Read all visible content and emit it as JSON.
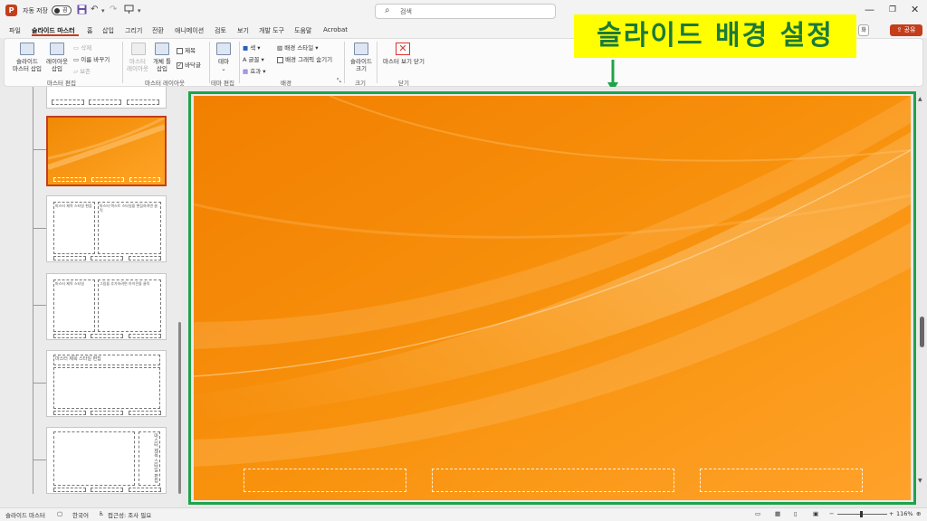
{
  "titlebar": {
    "app_icon": "powerpoint-icon",
    "autosave_label": "자동 저장",
    "autosave_state": "끔",
    "search_placeholder": "검색"
  },
  "menu": {
    "tabs": [
      "파일",
      "슬라이드 마스터",
      "홈",
      "삽입",
      "그리기",
      "전환",
      "애니메이션",
      "검토",
      "보기",
      "개발 도구",
      "도움말",
      "Acrobat"
    ],
    "active_tab": "슬라이드 마스터",
    "right_partial": "화",
    "share_label": "공유"
  },
  "ribbon": {
    "insert_slide_master": "슬라이드\n마스터 삽입",
    "insert_layout": "레이아웃\n삽입",
    "delete": "삭제",
    "rename": "이름 바꾸기",
    "preserve": "보존",
    "group_master_edit": "마스터 편집",
    "master_layout": "마스터\n레이아웃",
    "insert_placeholder": "개체 틀\n삽입",
    "title_check": "제목",
    "footer_check": "바닥글",
    "group_master_layout": "마스터 레이아웃",
    "themes": "테마",
    "group_theme_edit": "테마 편집",
    "colors": "색",
    "fonts": "글꼴",
    "effects": "효과",
    "bg_styles": "배경 스타일",
    "hide_bg_graphics": "배경 그래픽 숨기기",
    "group_background": "배경",
    "slide_size": "슬라이드\n크기",
    "group_size": "크기",
    "close_master_view": "마스터 보기 닫기",
    "group_close": "닫기"
  },
  "annotation": {
    "text": "슬라이드 배경 설정",
    "color": "#1fa34a",
    "bg": "#ffff00"
  },
  "thumbnails": {
    "t2_title": "마스터 제목 스타일 편집",
    "t2_body": "마스터 텍스트 스타일을 편집하려면 클릭",
    "t3_title": "마스터 제목 스타일",
    "t3_body": "그림을 추가하려면 아이콘을 클릭",
    "t4_title": "마스터 제목 스타일 편집",
    "t5_title": "마스터 제목 스타일 편집"
  },
  "slide": {
    "bg_color_main": "#f7930a",
    "bg_color_light": "#ffb84a"
  },
  "statusbar": {
    "mode": "슬라이드 마스터",
    "language": "한국어",
    "accessibility": "접근성: 조사 필요",
    "zoom": "116%"
  }
}
